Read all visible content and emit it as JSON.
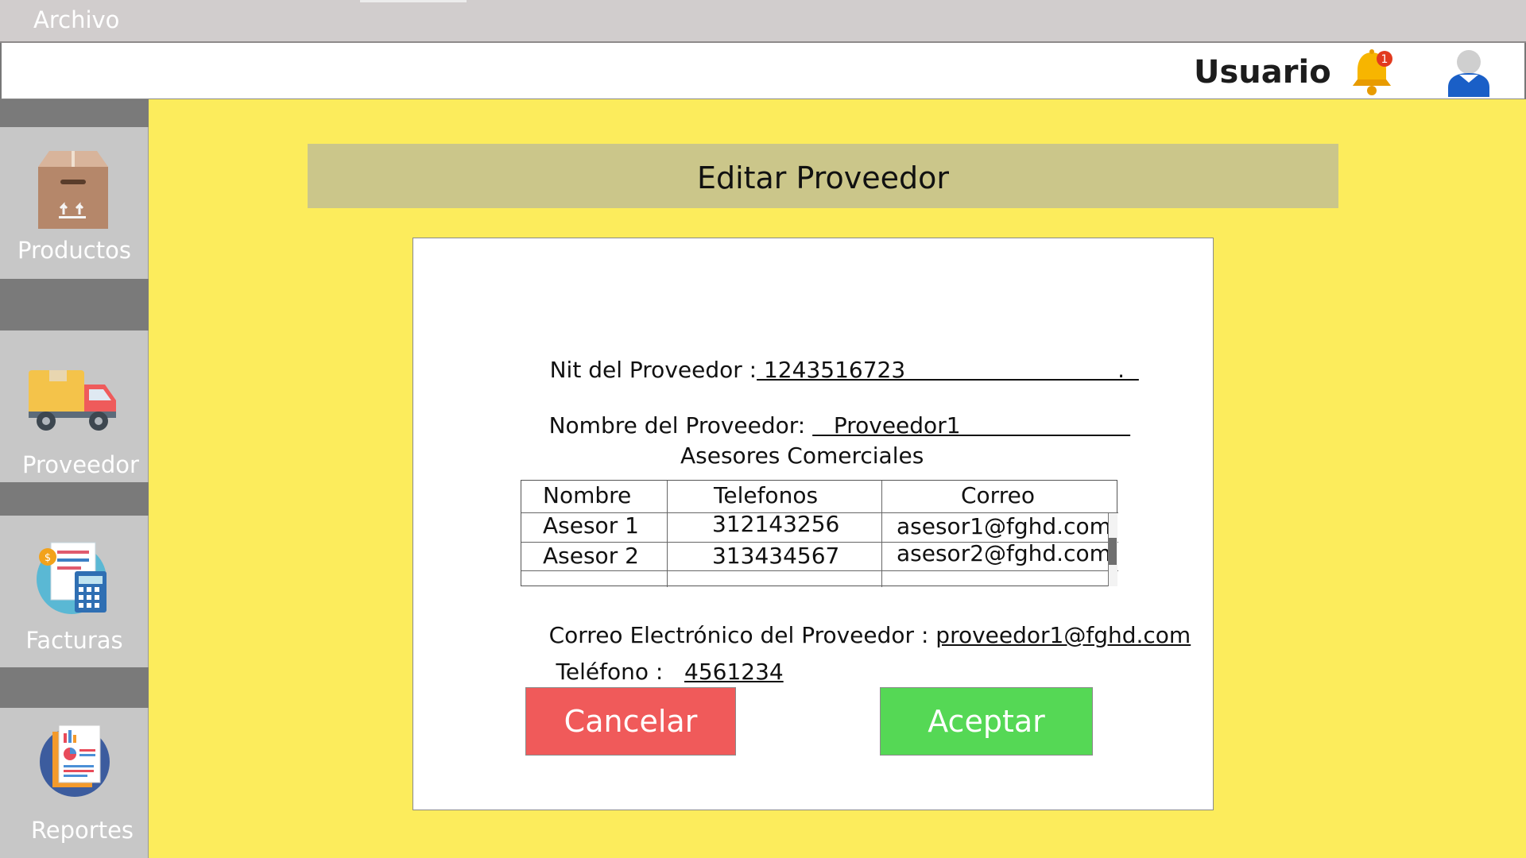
{
  "menu": {
    "archivo": "Archivo"
  },
  "header": {
    "user_label": "Usuario",
    "notification_count": "1"
  },
  "sidebar": {
    "items": [
      {
        "label": "Productos",
        "icon": "box-icon"
      },
      {
        "label": "Proveedor",
        "icon": "truck-icon"
      },
      {
        "label": "Facturas",
        "icon": "invoice-calculator-icon"
      },
      {
        "label": "Reportes",
        "icon": "report-chart-icon"
      }
    ]
  },
  "page": {
    "title": "Editar Proveedor"
  },
  "form": {
    "nit_label": "Nit del Proveedor :",
    "nit_value": " 1243516723                              .  ",
    "name_label": "Nombre del Proveedor: ",
    "name_value": "   Proveedor1                        ",
    "advisors_title": "Asesores Comerciales",
    "table": {
      "headers": [
        "Nombre",
        "Telefonos",
        "Correo"
      ],
      "rows": [
        [
          "Asesor 1",
          "312143256",
          "asesor1@fghd.com"
        ],
        [
          "Asesor 2",
          "313434567",
          "asesor2@fghd.com"
        ]
      ]
    },
    "email_label": "Correo Electrónico del Proveedor : ",
    "email_value": "proveedor1@fghd.com",
    "phone_label": " Teléfono :   ",
    "phone_value": "4561234",
    "cancel_label": "Cancelar",
    "accept_label": "Aceptar"
  },
  "colors": {
    "background": "#fcec5c",
    "title_band": "#cbc68a",
    "cancel": "#f05a5a",
    "accept": "#55d855",
    "sidebar": "#7a7a7a"
  }
}
